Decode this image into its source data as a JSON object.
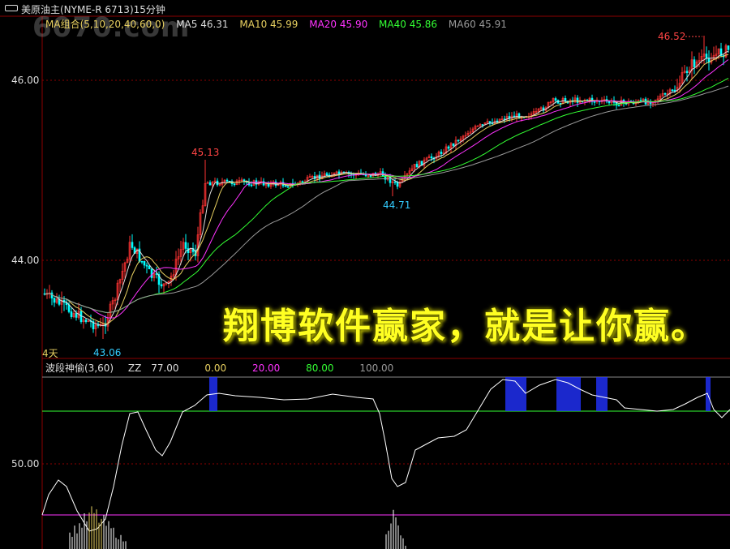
{
  "header": {
    "title": "美原油主(NYME-R 6713)15分钟",
    "symbol_icon": "window-icon"
  },
  "watermark": "6070.com",
  "ma_legend": [
    {
      "label": "MA组合(5,10,20,40,60,0)",
      "color": "#e8d060"
    },
    {
      "label": "MA5 46.31",
      "color": "#dddddd"
    },
    {
      "label": "MA10 45.99",
      "color": "#e8d060"
    },
    {
      "label": "MA20 45.90",
      "color": "#ff33ff"
    },
    {
      "label": "MA40 45.86",
      "color": "#33ff33"
    },
    {
      "label": "MA60 45.91",
      "color": "#999999"
    }
  ],
  "price_axis": [
    "46.00",
    "44.00"
  ],
  "price_labels": {
    "high": "45.13",
    "low_mid": "44.71",
    "low": "43.06",
    "peak": "46.52"
  },
  "days_label": "4天",
  "indicator_legend": [
    {
      "label": "波段神偷(3,60)",
      "color": "#dddddd"
    },
    {
      "label": "ZZ",
      "color": "#dddddd"
    },
    {
      "label": "77.00",
      "color": "#dddddd"
    },
    {
      "label": "0.00",
      "color": "#e8d060"
    },
    {
      "label": "20.00",
      "color": "#ff33ff"
    },
    {
      "label": "80.00",
      "color": "#33ff33"
    },
    {
      "label": "100.00",
      "color": "#999999"
    }
  ],
  "indicator_axis": "50.00",
  "slogan": "翔博软件赢家，就是让你赢。",
  "colors": {
    "up": "#ff3333",
    "down": "#00ffff",
    "grid": "#8b0000",
    "axis": "#8b0000"
  }
}
